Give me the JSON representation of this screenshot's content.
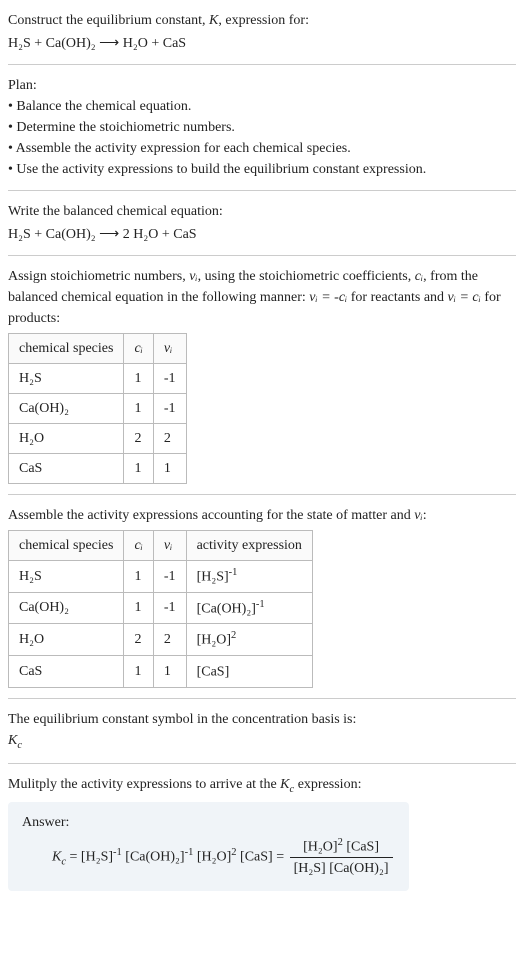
{
  "intro": {
    "line1_a": "Construct the equilibrium constant, ",
    "line1_k": "K",
    "line1_b": ", expression for:",
    "eq_lhs": "H₂S + Ca(OH)₂",
    "arrow": "⟶",
    "eq_rhs": "H₂O + CaS"
  },
  "plan": {
    "heading": "Plan:",
    "b1": "• Balance the chemical equation.",
    "b2": "• Determine the stoichiometric numbers.",
    "b3": "• Assemble the activity expression for each chemical species.",
    "b4": "• Use the activity expressions to build the equilibrium constant expression."
  },
  "balanced": {
    "heading": "Write the balanced chemical equation:",
    "lhs": "H₂S + Ca(OH)₂",
    "arrow": "⟶",
    "rhs": "2 H₂O + CaS"
  },
  "assign": {
    "text_a": "Assign stoichiometric numbers, ",
    "nu_i": "νᵢ",
    "text_b": ", using the stoichiometric coefficients, ",
    "c_i": "cᵢ",
    "text_c": ", from the balanced chemical equation in the following manner: ",
    "rel1": "νᵢ = -cᵢ",
    "text_d": " for reactants and ",
    "rel2": "νᵢ = cᵢ",
    "text_e": " for products:"
  },
  "table1": {
    "h1": "chemical species",
    "h2": "cᵢ",
    "h3": "νᵢ",
    "rows": [
      {
        "sp": "H₂S",
        "c": "1",
        "v": "-1"
      },
      {
        "sp": "Ca(OH)₂",
        "c": "1",
        "v": "-1"
      },
      {
        "sp": "H₂O",
        "c": "2",
        "v": "2"
      },
      {
        "sp": "CaS",
        "c": "1",
        "v": "1"
      }
    ]
  },
  "assemble": {
    "text_a": "Assemble the activity expressions accounting for the state of matter and ",
    "nu_i": "νᵢ",
    "text_b": ":"
  },
  "table2": {
    "h1": "chemical species",
    "h2": "cᵢ",
    "h3": "νᵢ",
    "h4": "activity expression",
    "rows": [
      {
        "sp": "H₂S",
        "c": "1",
        "v": "-1",
        "act_base": "[H₂S]",
        "act_exp": "-1"
      },
      {
        "sp": "Ca(OH)₂",
        "c": "1",
        "v": "-1",
        "act_base": "[Ca(OH)₂]",
        "act_exp": "-1"
      },
      {
        "sp": "H₂O",
        "c": "2",
        "v": "2",
        "act_base": "[H₂O]",
        "act_exp": "2"
      },
      {
        "sp": "CaS",
        "c": "1",
        "v": "1",
        "act_base": "[CaS]",
        "act_exp": ""
      }
    ]
  },
  "symbol": {
    "line": "The equilibrium constant symbol in the concentration basis is:",
    "kc_k": "K",
    "kc_c": "c"
  },
  "final": {
    "heading_a": "Mulitply the activity expressions to arrive at the ",
    "kc_k": "K",
    "kc_c": "c",
    "heading_b": " expression:",
    "answer_label": "Answer:",
    "kc_eq": " = ",
    "f1_base": "[H₂S]",
    "f1_exp": "-1",
    "f2_base": "[Ca(OH)₂]",
    "f2_exp": "-1",
    "f3_base": "[H₂O]",
    "f3_exp": "2",
    "f4_base": "[CaS]",
    "eq2": " = ",
    "num_a": "[H₂O]",
    "num_a_exp": "2",
    "num_b": " [CaS]",
    "den": "[H₂S] [Ca(OH)₂]"
  },
  "chart_data": {
    "type": "table",
    "title": "Stoichiometric numbers and activity expressions for H2S + Ca(OH)2 -> 2 H2O + CaS",
    "columns": [
      "chemical species",
      "c_i",
      "nu_i",
      "activity expression"
    ],
    "rows": [
      [
        "H2S",
        1,
        -1,
        "[H2S]^-1"
      ],
      [
        "Ca(OH)2",
        1,
        -1,
        "[Ca(OH)2]^-1"
      ],
      [
        "H2O",
        2,
        2,
        "[H2O]^2"
      ],
      [
        "CaS",
        1,
        1,
        "[CaS]"
      ]
    ],
    "equilibrium_constant": "K_c = [H2O]^2 [CaS] / ([H2S] [Ca(OH)2])"
  }
}
